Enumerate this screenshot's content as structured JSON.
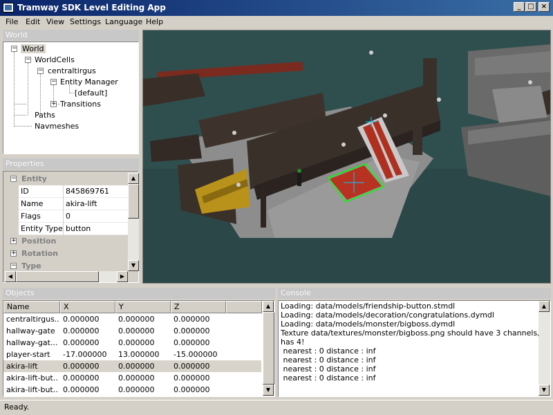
{
  "window": {
    "title": "Tramway SDK Level Editing App"
  },
  "menu": [
    "File",
    "Edit",
    "View",
    "Settings",
    "Language",
    "Help"
  ],
  "panels": {
    "world": "World",
    "properties": "Properties",
    "objects": "Objects",
    "console": "Console"
  },
  "tree": {
    "world": "World",
    "worldcells": "WorldCells",
    "cell": "centraltirgus",
    "entity_manager": "Entity Manager",
    "default": "[default]",
    "transitions": "Transitions",
    "paths": "Paths",
    "navmeshes": "Navmeshes"
  },
  "properties": {
    "group_entity": "Entity",
    "rows": [
      {
        "key": "ID",
        "value": "845869761"
      },
      {
        "key": "Name",
        "value": "akira-lift"
      },
      {
        "key": "Flags",
        "value": "0"
      },
      {
        "key": "Entity Type",
        "value": "button"
      }
    ],
    "group_position": "Position",
    "group_rotation": "Rotation",
    "group_type": "Type"
  },
  "objects": {
    "columns": [
      "Name",
      "X",
      "Y",
      "Z"
    ],
    "rows": [
      [
        "centraltirgus...",
        "0.000000",
        "0.000000",
        "0.000000"
      ],
      [
        "hallway-gate",
        "0.000000",
        "0.000000",
        "0.000000"
      ],
      [
        "hallway-gat...",
        "0.000000",
        "0.000000",
        "0.000000"
      ],
      [
        "player-start",
        "-17.000000",
        "13.000000",
        "-15.000000"
      ],
      [
        "akira-lift",
        "0.000000",
        "0.000000",
        "0.000000"
      ],
      [
        "akira-lift-but...",
        "0.000000",
        "0.000000",
        "0.000000"
      ],
      [
        "akira-lift-but...",
        "0.000000",
        "0.000000",
        "0.000000"
      ]
    ],
    "selected_index": 4
  },
  "console": [
    "Loading: data/models/friendship-button.stmdl",
    "Loading: data/models/decoration/congratulations.dymdl",
    "Loading: data/models/monster/bigboss.dymdl",
    "Texture data/textures/monster/bigboss.png should have 3 channels, but it",
    "has 4!",
    " nearest : 0 distance : inf",
    " nearest : 0 distance : inf",
    " nearest : 0 distance : inf",
    " nearest : 0 distance : inf"
  ],
  "status": "Ready.",
  "icons": {
    "minimize": "minimize-icon",
    "maximize": "maximize-icon",
    "close": "close-icon"
  },
  "colors": {
    "titlebar": "#0a246a",
    "viewport_sky": "#2f4f4f",
    "selection_box": "#00ff00"
  }
}
